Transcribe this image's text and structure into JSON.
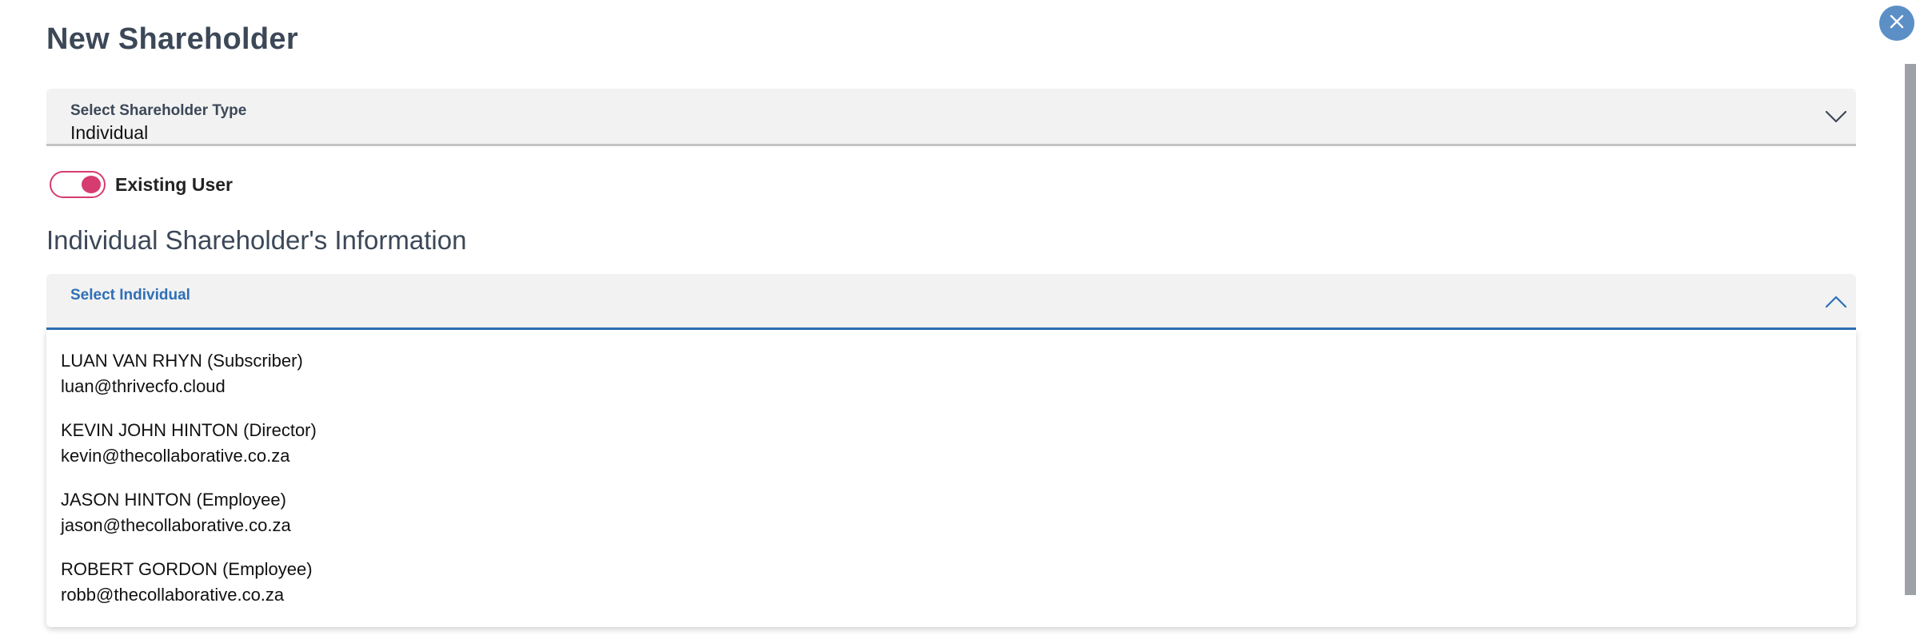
{
  "dialog": {
    "title": "New Shareholder"
  },
  "shareholder_type": {
    "label": "Select Shareholder Type",
    "value": "Individual"
  },
  "existing_user_toggle": {
    "label": "Existing User",
    "state": "on"
  },
  "section": {
    "heading": "Individual Shareholder's Information"
  },
  "individual_select": {
    "label": "Select Individual",
    "value": "",
    "expanded": true,
    "options": [
      {
        "name": "LUAN VAN RHYN (Subscriber)",
        "email": "luan@thrivecfo.cloud"
      },
      {
        "name": "KEVIN JOHN HINTON (Director)",
        "email": "kevin@thecollaborative.co.za"
      },
      {
        "name": "JASON HINTON (Employee)",
        "email": "jason@thecollaborative.co.za"
      },
      {
        "name": "ROBERT GORDON (Employee)",
        "email": "robb@thecollaborative.co.za"
      }
    ]
  },
  "colors": {
    "accent_blue": "#2e6fb7",
    "toggle_pink": "#d63c6f",
    "close_button": "#5b8fc6",
    "heading_text": "#3c4858"
  },
  "icons": {
    "close": "close-icon",
    "type_chevron": "chevron-down-icon",
    "individual_chevron": "chevron-up-icon"
  }
}
